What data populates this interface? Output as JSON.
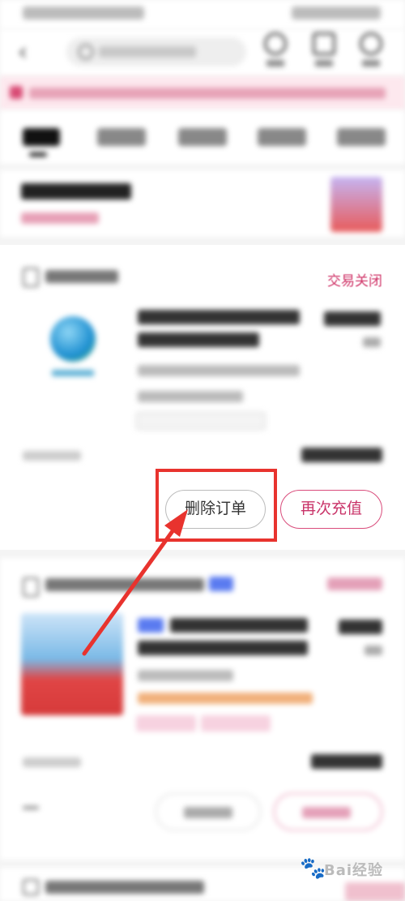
{
  "order": {
    "status": "交易关闭",
    "delete_label": "删除订单",
    "recharge_label": "再次充值"
  },
  "watermark": {
    "text": "Bai经验"
  },
  "colors": {
    "accent_pink": "#d0376a",
    "highlight_red": "#e8332e",
    "notice_bg": "#fde8ee",
    "tab_badge_blue": "#5a7bf0"
  },
  "icons": [
    "back-icon",
    "search-icon",
    "header-action-icon",
    "shop-icon",
    "arrow-annotation",
    "baidu-paw-icon"
  ]
}
